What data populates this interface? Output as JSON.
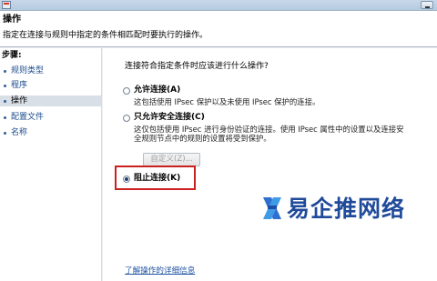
{
  "header": {
    "title": "操作",
    "description": "指定在连接与规则中指定的条件相匹配时要执行的操作。"
  },
  "sidebar": {
    "label": "步骤:",
    "items": [
      {
        "label": "规则类型",
        "active": false
      },
      {
        "label": "程序",
        "active": false
      },
      {
        "label": "操作",
        "active": true
      },
      {
        "label": "配置文件",
        "active": false
      },
      {
        "label": "名称",
        "active": false
      }
    ]
  },
  "main": {
    "question": "连接符合指定条件时应该进行什么操作?",
    "options": [
      {
        "label": "允许连接(A)",
        "description": "这包括使用 IPsec 保护以及未使用 IPsec 保护的连接。",
        "checked": false
      },
      {
        "label": "只允许安全连接(C)",
        "description": "这仅包括使用 IPsec 进行身份验证的连接。使用 IPsec 属性中的设置以及连接安全规则节点中的规则的设置将受到保护。",
        "checked": false
      },
      {
        "label": "阻止连接(K)",
        "description": "",
        "checked": true
      }
    ],
    "custom_button": "自定义(Z)...",
    "learn_more": "了解操作的详细信息"
  },
  "watermark": {
    "text": "易企推网络"
  },
  "colors": {
    "highlight_border": "#cc1f1f",
    "link": "#1f53a3",
    "watermark": "#204a9a"
  }
}
